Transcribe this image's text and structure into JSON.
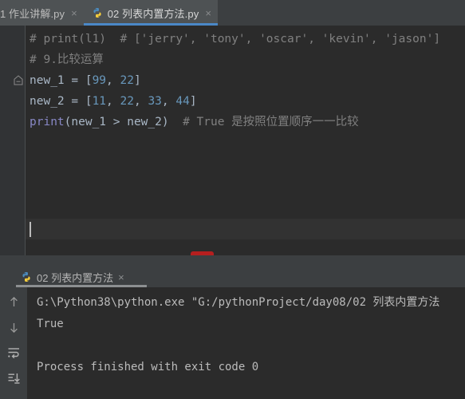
{
  "window": {
    "theme_bg": "#3c3f41",
    "editor_bg": "#2b2b2b",
    "accent": "#4a88c7"
  },
  "editor_tabs": [
    {
      "label": "1 作业讲解.py",
      "close": "×",
      "icon": "python-file-icon",
      "active": false
    },
    {
      "label": "02 列表内置方法.py",
      "close": "×",
      "icon": "python-file-icon",
      "active": true
    }
  ],
  "code": {
    "line1_comment": "# print(l1)  # ['jerry', 'tony', 'oscar', 'kevin', 'jason']",
    "line2_comment": "# 9.比较运算",
    "line3": {
      "var": "new_1",
      "eq": " = [",
      "n1": "99",
      "comma": ", ",
      "n2": "22",
      "close": "]"
    },
    "line4": {
      "var": "new_2",
      "eq": " = [",
      "n1": "11",
      "comma": ", ",
      "n2": "22",
      "n3": "33",
      "n4": "44",
      "close": "]"
    },
    "line5": {
      "fn": "print",
      "args": "(new_1 > new_2)",
      "comment": "  # True 是按照位置顺序一一比较"
    }
  },
  "search_button": {
    "icon": "search-icon",
    "color": "#b51f1f"
  },
  "run_tab": {
    "label": "02 列表内置方法",
    "close": "×",
    "icon": "python-run-icon"
  },
  "run_toolbar": [
    {
      "name": "up-arrow-icon",
      "glyph": "↑"
    },
    {
      "name": "down-arrow-icon",
      "glyph": "↓"
    },
    {
      "name": "soft-wrap-icon",
      "glyph": "↩"
    },
    {
      "name": "scroll-to-end-icon",
      "glyph": "↓"
    }
  ],
  "console": {
    "line_command": "G:\\Python38\\python.exe \"G:/pythonProject/day08/02 列表内置方法",
    "line_output": "True",
    "line_exit": "Process finished with exit code 0"
  }
}
